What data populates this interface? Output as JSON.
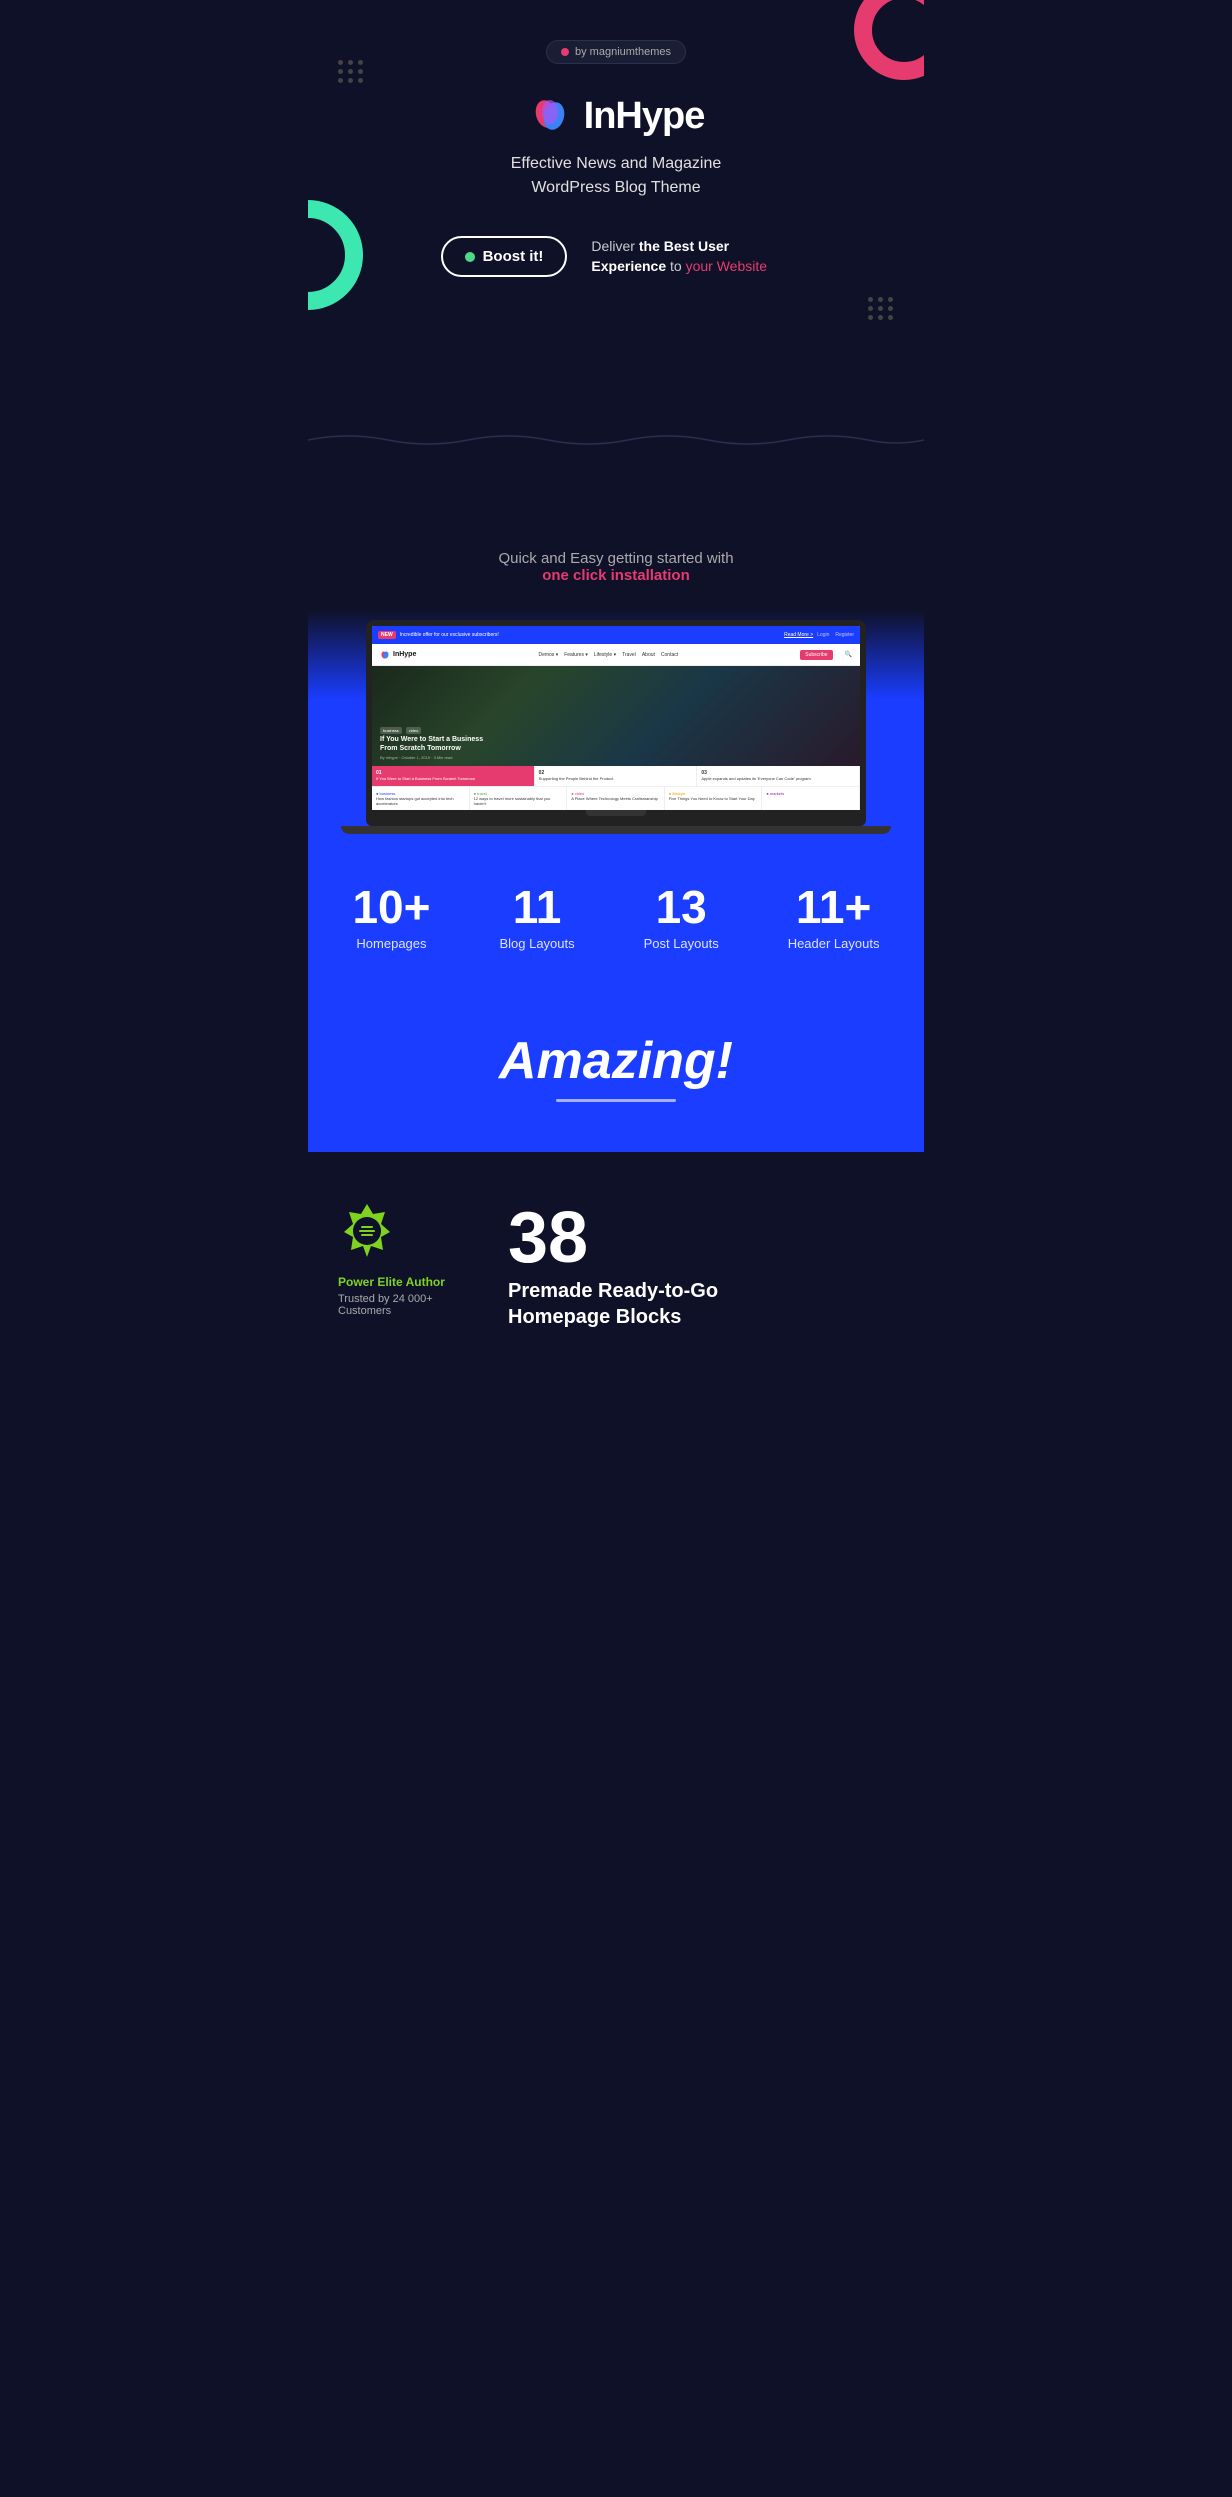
{
  "badge": {
    "dot_color": "#e63b6f",
    "text": "by magniumthemes"
  },
  "hero": {
    "logo_text": "InHype",
    "subtitle_line1": "Effective News and Magazine",
    "subtitle_line2": "WordPress Blog Theme",
    "boost_button": "Boost it!",
    "tagline_prefix": "Deliver ",
    "tagline_bold": "the Best User Experience",
    "tagline_suffix": " to ",
    "tagline_highlight": "your Website"
  },
  "install": {
    "text": "Quick and Easy getting started with",
    "highlight": "one click installation"
  },
  "mini_browser": {
    "topbar_badge": "NEW",
    "topbar_text": "Incredible offer for our exclusive subscribers!",
    "topbar_link": "Read More >",
    "topbar_links": [
      "Login",
      "Register"
    ],
    "nav_logo": "InHype",
    "nav_items": [
      "Demos",
      "Features",
      "Lifestyle",
      "Travel",
      "About",
      "Contact"
    ],
    "nav_subscribe": "Subscribe",
    "hero_badges": [
      "business",
      "video"
    ],
    "hero_title": "If You Were to Start a Business From Scratch Tomorrow",
    "hero_meta": "By Inhype · October 1, 2019 · 3 Min read",
    "cards": [
      {
        "num": "01",
        "title": "If You Were to Start a Business From Scratch Tomorrow"
      },
      {
        "num": "02",
        "title": "Supporting the People Behind the Product"
      },
      {
        "num": "03",
        "title": "Apple expands and updates its 'Everyone Can Code' program"
      }
    ],
    "posts": [
      {
        "cat": "business",
        "title": "How fashion startups got accepted into tech accelerators"
      },
      {
        "cat": "travel",
        "title": "12 ways to travel more sustainably that you haven't"
      },
      {
        "cat": "video",
        "title": "A Place Where Technology Meets Craftsmanship"
      },
      {
        "cat": "lifestyle",
        "title": "Five Things You Need to Know to Start Your Day"
      },
      {
        "cat": "markets",
        "title": ""
      }
    ]
  },
  "stats": [
    {
      "number": "10+",
      "label": "Homepages"
    },
    {
      "number": "11",
      "label": "Blog Layouts"
    },
    {
      "number": "13",
      "label": "Post Layouts"
    },
    {
      "number": "11+",
      "label": "Header Layouts"
    }
  ],
  "amazing": {
    "text": "Amazing!"
  },
  "bottom": {
    "author_badge_color": "#7ed321",
    "power_elite_label": "Power Elite Author",
    "trusted_text": "Trusted by 24 000+ Customers",
    "blocks_number": "38",
    "blocks_label_line1": "Premade Ready-to-Go",
    "blocks_label_line2": "Homepage Blocks"
  }
}
